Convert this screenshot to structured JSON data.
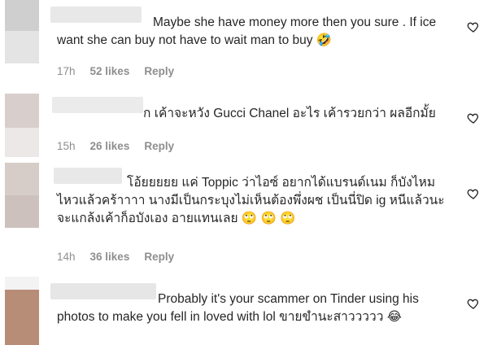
{
  "comments": [
    {
      "text": "Maybe she have money more then you sure . If ice want she can buy not have to wait man to buy 🤣",
      "time": "17h",
      "likes": "52 likes",
      "reply": "Reply"
    },
    {
      "text": "ก เค้าจะหวัง Gucci Chanel อะไร เค้ารวยกว่า ผลอีกมั้ย",
      "time": "15h",
      "likes": "26 likes",
      "reply": "Reply"
    },
    {
      "text": "โอ้ยยยยย แค่ Toppic ว่าไอซ์ อยากได้แบรนด์เนม ก็บังไหมไหวแล้วคร้าาาา นางมีเป็นกระบุงไม่เห็นต้องพึ่งผช เป็นนี่ปิด ig หนีแล้วนะ จะแกล้งเค้าก็อบังเอง อายแทนเลย 🙄 🙄 🙄",
      "time": "14h",
      "likes": "36 likes",
      "reply": "Reply"
    },
    {
      "text": "Probably it's your scammer on Tinder using his photos to make you fell in loved with lol ขายขำนะสาววววว 😂",
      "time": "",
      "likes": "",
      "reply": ""
    }
  ],
  "icons": {
    "like": "heart-outline-icon"
  },
  "colors": {
    "meta": "#8e8e8e",
    "text": "#262626",
    "redaction": "#e0e0e0"
  }
}
